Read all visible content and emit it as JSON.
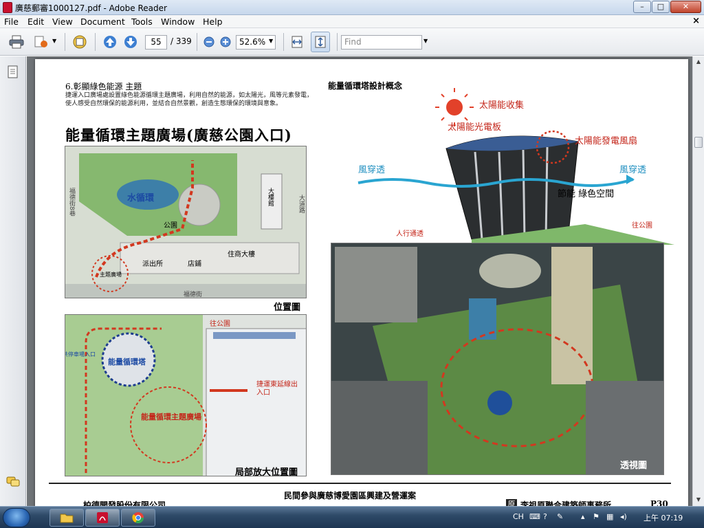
{
  "window": {
    "title": "廣慈郵審1000127.pdf - Adobe Reader",
    "min_symbol": "–",
    "max_symbol": "□",
    "close_symbol": "✕"
  },
  "menu": {
    "items": [
      "File",
      "Edit",
      "View",
      "Document",
      "Tools",
      "Window",
      "Help"
    ],
    "close_symbol": "×"
  },
  "toolbar": {
    "page_current": "55",
    "page_total": "/ 339",
    "zoom": "52.6%",
    "find_placeholder": "Find",
    "icons": [
      "print-icon",
      "share-icon",
      "collaborate-icon",
      "page-up-icon",
      "page-down-icon",
      "zoom-out-icon",
      "zoom-in-icon",
      "fit-page-icon",
      "fit-width-icon"
    ]
  },
  "nav": {
    "icons": [
      "pages-icon",
      "comments-icon"
    ]
  },
  "page": {
    "section_heading": "6.彰顯綠色能源 主題",
    "section_desc": "捷運入口廣場處設置綠色能源循環主題廣場，利用自然的能源，如太陽光，風等元素發電，使人感受自然環保的能源利用，並結合自然景觀，創造生態環保的環境與意象。",
    "main_title": "能量循環主題廣場(廣慈公園入口)",
    "tower_title": "能量循環塔設計概念",
    "site_plan": {
      "caption": "位置圖",
      "labels": {
        "water": "水循環",
        "park": "公園",
        "police": "派出所",
        "shop": "店鋪",
        "residential": "住商大樓",
        "plaza": "主題廣場",
        "street_bottom": "福德街",
        "street_left": "福德街8巷",
        "building_right": "大樓館",
        "street_right": "大道路"
      }
    },
    "detail_plan": {
      "caption": "局部放大位置圖",
      "labels": {
        "to_park": "往公園",
        "bus_entry": "公共停車場入口",
        "energy_tower": "能量循環塔",
        "metro": "捷運東延線出入口",
        "plaza": "能量循環主題廣場"
      }
    },
    "tower_diagram": {
      "solar_collect": "太陽能收集",
      "solar_panel": "太陽能光電板",
      "wind_fan": "太陽能發電風扇",
      "wind_in": "風穿透",
      "wind_out": "風穿透",
      "green_space": "節能 綠色空間",
      "walkway": "人行通透",
      "to_park": "往公園"
    },
    "perspective": {
      "caption": "透視圖"
    },
    "footer": {
      "project": "民間參與廣慈博愛園區興建及營運案",
      "company_left": "柏德開發股份有限公司",
      "company_right": "李祖原聯合建築師事務所",
      "company_right_mark": "原",
      "page_no": "P30"
    }
  },
  "taskbar": {
    "lang": "CH",
    "time": "上午 07:19",
    "apps": [
      "explorer-icon",
      "acrobat-icon",
      "chrome-icon"
    ]
  }
}
